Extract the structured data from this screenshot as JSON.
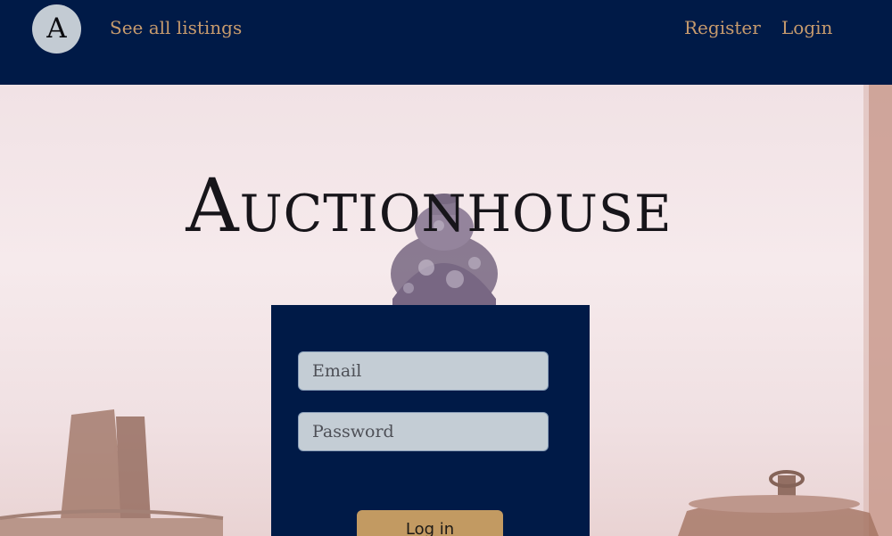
{
  "navbar": {
    "logo_letter": "A",
    "links": {
      "listings": "See all listings",
      "register": "Register",
      "login": "Login"
    }
  },
  "hero": {
    "title": "Auctionhouse"
  },
  "login_form": {
    "email_placeholder": "Email",
    "password_placeholder": "Password",
    "submit_label": "Log in"
  },
  "colors": {
    "navy": "#001a47",
    "accent_gold": "#c79b6d",
    "button_gold": "#c29a62",
    "input_bg": "#c4cdd5"
  }
}
